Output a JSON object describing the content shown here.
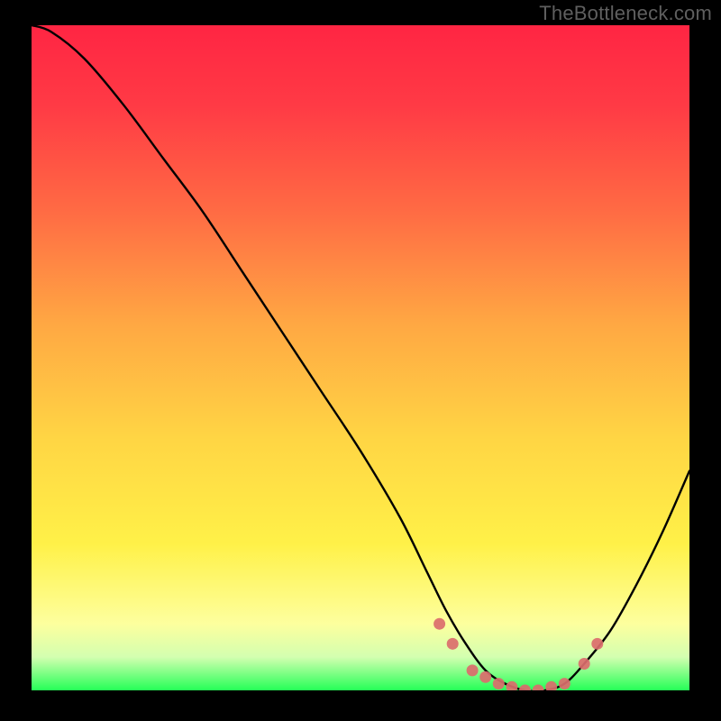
{
  "watermark": "TheBottleneck.com",
  "colors": {
    "background": "#000000",
    "gradient_top": "#ff2642",
    "gradient_mid1": "#ff8a3a",
    "gradient_mid2": "#ffe84a",
    "gradient_low": "#fffbb0",
    "gradient_bottom": "#2bff5f",
    "curve": "#000000",
    "marker": "#db6c6d",
    "watermark_text": "#5f5f5f"
  },
  "chart_data": {
    "type": "line",
    "title": "",
    "subtitle": "",
    "xlabel": "",
    "ylabel": "",
    "xlim": [
      0,
      100
    ],
    "ylim": [
      0,
      100
    ],
    "grid": false,
    "legend_position": "none",
    "background_gradient": "vertical red→orange→yellow→green",
    "series": [
      {
        "name": "bottleneck-curve",
        "x": [
          0,
          3,
          8,
          14,
          20,
          26,
          32,
          38,
          44,
          50,
          56,
          60,
          63,
          66,
          69,
          72,
          75,
          78,
          81,
          84,
          88,
          92,
          96,
          100
        ],
        "y": [
          100,
          99,
          95,
          88,
          80,
          72,
          63,
          54,
          45,
          36,
          26,
          18,
          12,
          7,
          3,
          1,
          0,
          0,
          1,
          4,
          9,
          16,
          24,
          33
        ]
      }
    ],
    "markers": [
      {
        "name": "marker-left-cluster-1",
        "x": 62,
        "y": 10
      },
      {
        "name": "marker-left-cluster-2",
        "x": 64,
        "y": 7
      },
      {
        "name": "marker-flat-1",
        "x": 67,
        "y": 3
      },
      {
        "name": "marker-flat-2",
        "x": 69,
        "y": 2
      },
      {
        "name": "marker-flat-3",
        "x": 71,
        "y": 1
      },
      {
        "name": "marker-flat-4",
        "x": 73,
        "y": 0.5
      },
      {
        "name": "marker-flat-5",
        "x": 75,
        "y": 0
      },
      {
        "name": "marker-flat-6",
        "x": 77,
        "y": 0
      },
      {
        "name": "marker-flat-7",
        "x": 79,
        "y": 0.5
      },
      {
        "name": "marker-flat-8",
        "x": 81,
        "y": 1
      },
      {
        "name": "marker-right-cluster-1",
        "x": 84,
        "y": 4
      },
      {
        "name": "marker-right-cluster-2",
        "x": 86,
        "y": 7
      }
    ]
  }
}
